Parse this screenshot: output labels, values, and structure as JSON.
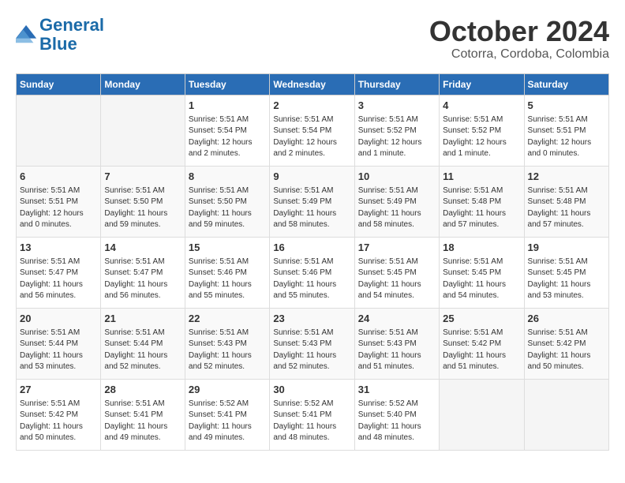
{
  "header": {
    "logo_line1": "General",
    "logo_line2": "Blue",
    "month": "October 2024",
    "location": "Cotorra, Cordoba, Colombia"
  },
  "weekdays": [
    "Sunday",
    "Monday",
    "Tuesday",
    "Wednesday",
    "Thursday",
    "Friday",
    "Saturday"
  ],
  "weeks": [
    [
      {
        "num": "",
        "info": ""
      },
      {
        "num": "",
        "info": ""
      },
      {
        "num": "1",
        "info": "Sunrise: 5:51 AM\nSunset: 5:54 PM\nDaylight: 12 hours\nand 2 minutes."
      },
      {
        "num": "2",
        "info": "Sunrise: 5:51 AM\nSunset: 5:54 PM\nDaylight: 12 hours\nand 2 minutes."
      },
      {
        "num": "3",
        "info": "Sunrise: 5:51 AM\nSunset: 5:52 PM\nDaylight: 12 hours\nand 1 minute."
      },
      {
        "num": "4",
        "info": "Sunrise: 5:51 AM\nSunset: 5:52 PM\nDaylight: 12 hours\nand 1 minute."
      },
      {
        "num": "5",
        "info": "Sunrise: 5:51 AM\nSunset: 5:51 PM\nDaylight: 12 hours\nand 0 minutes."
      }
    ],
    [
      {
        "num": "6",
        "info": "Sunrise: 5:51 AM\nSunset: 5:51 PM\nDaylight: 12 hours\nand 0 minutes."
      },
      {
        "num": "7",
        "info": "Sunrise: 5:51 AM\nSunset: 5:50 PM\nDaylight: 11 hours\nand 59 minutes."
      },
      {
        "num": "8",
        "info": "Sunrise: 5:51 AM\nSunset: 5:50 PM\nDaylight: 11 hours\nand 59 minutes."
      },
      {
        "num": "9",
        "info": "Sunrise: 5:51 AM\nSunset: 5:49 PM\nDaylight: 11 hours\nand 58 minutes."
      },
      {
        "num": "10",
        "info": "Sunrise: 5:51 AM\nSunset: 5:49 PM\nDaylight: 11 hours\nand 58 minutes."
      },
      {
        "num": "11",
        "info": "Sunrise: 5:51 AM\nSunset: 5:48 PM\nDaylight: 11 hours\nand 57 minutes."
      },
      {
        "num": "12",
        "info": "Sunrise: 5:51 AM\nSunset: 5:48 PM\nDaylight: 11 hours\nand 57 minutes."
      }
    ],
    [
      {
        "num": "13",
        "info": "Sunrise: 5:51 AM\nSunset: 5:47 PM\nDaylight: 11 hours\nand 56 minutes."
      },
      {
        "num": "14",
        "info": "Sunrise: 5:51 AM\nSunset: 5:47 PM\nDaylight: 11 hours\nand 56 minutes."
      },
      {
        "num": "15",
        "info": "Sunrise: 5:51 AM\nSunset: 5:46 PM\nDaylight: 11 hours\nand 55 minutes."
      },
      {
        "num": "16",
        "info": "Sunrise: 5:51 AM\nSunset: 5:46 PM\nDaylight: 11 hours\nand 55 minutes."
      },
      {
        "num": "17",
        "info": "Sunrise: 5:51 AM\nSunset: 5:45 PM\nDaylight: 11 hours\nand 54 minutes."
      },
      {
        "num": "18",
        "info": "Sunrise: 5:51 AM\nSunset: 5:45 PM\nDaylight: 11 hours\nand 54 minutes."
      },
      {
        "num": "19",
        "info": "Sunrise: 5:51 AM\nSunset: 5:45 PM\nDaylight: 11 hours\nand 53 minutes."
      }
    ],
    [
      {
        "num": "20",
        "info": "Sunrise: 5:51 AM\nSunset: 5:44 PM\nDaylight: 11 hours\nand 53 minutes."
      },
      {
        "num": "21",
        "info": "Sunrise: 5:51 AM\nSunset: 5:44 PM\nDaylight: 11 hours\nand 52 minutes."
      },
      {
        "num": "22",
        "info": "Sunrise: 5:51 AM\nSunset: 5:43 PM\nDaylight: 11 hours\nand 52 minutes."
      },
      {
        "num": "23",
        "info": "Sunrise: 5:51 AM\nSunset: 5:43 PM\nDaylight: 11 hours\nand 52 minutes."
      },
      {
        "num": "24",
        "info": "Sunrise: 5:51 AM\nSunset: 5:43 PM\nDaylight: 11 hours\nand 51 minutes."
      },
      {
        "num": "25",
        "info": "Sunrise: 5:51 AM\nSunset: 5:42 PM\nDaylight: 11 hours\nand 51 minutes."
      },
      {
        "num": "26",
        "info": "Sunrise: 5:51 AM\nSunset: 5:42 PM\nDaylight: 11 hours\nand 50 minutes."
      }
    ],
    [
      {
        "num": "27",
        "info": "Sunrise: 5:51 AM\nSunset: 5:42 PM\nDaylight: 11 hours\nand 50 minutes."
      },
      {
        "num": "28",
        "info": "Sunrise: 5:51 AM\nSunset: 5:41 PM\nDaylight: 11 hours\nand 49 minutes."
      },
      {
        "num": "29",
        "info": "Sunrise: 5:52 AM\nSunset: 5:41 PM\nDaylight: 11 hours\nand 49 minutes."
      },
      {
        "num": "30",
        "info": "Sunrise: 5:52 AM\nSunset: 5:41 PM\nDaylight: 11 hours\nand 48 minutes."
      },
      {
        "num": "31",
        "info": "Sunrise: 5:52 AM\nSunset: 5:40 PM\nDaylight: 11 hours\nand 48 minutes."
      },
      {
        "num": "",
        "info": ""
      },
      {
        "num": "",
        "info": ""
      }
    ]
  ]
}
